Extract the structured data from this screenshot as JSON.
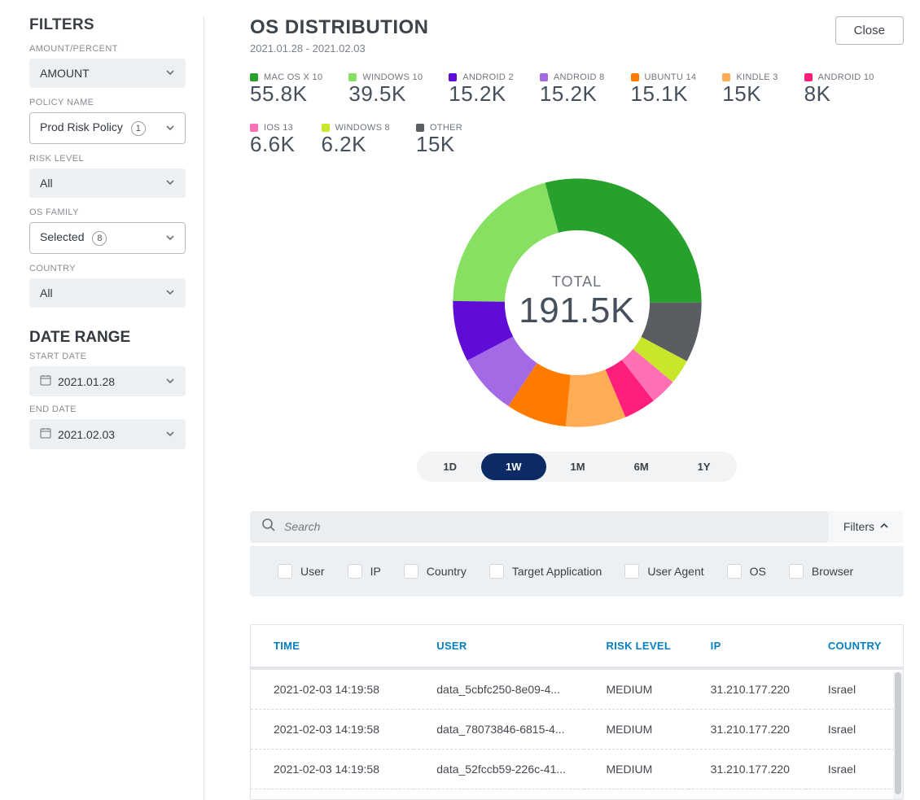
{
  "sidebar": {
    "filters_title": "FILTERS",
    "amount_percent_label": "AMOUNT/PERCENT",
    "amount_percent_value": "AMOUNT",
    "policy_label": "POLICY NAME",
    "policy_value": "Prod Risk Policy",
    "policy_count": "1",
    "risk_label": "RISK LEVEL",
    "risk_value": "All",
    "os_family_label": "OS FAMILY",
    "os_family_value": "Selected",
    "os_family_count": "8",
    "country_label": "COUNTRY",
    "country_value": "All",
    "date_range_title": "DATE RANGE",
    "start_date_label": "START DATE",
    "start_date_value": "2021.01.28",
    "end_date_label": "END DATE",
    "end_date_value": "2021.02.03"
  },
  "header": {
    "title": "OS DISTRIBUTION",
    "subtitle": "2021.01.28 - 2021.02.03",
    "close": "Close"
  },
  "legend": [
    {
      "label": "MAC OS X 10",
      "value": "55.8K",
      "color": "#27a12b"
    },
    {
      "label": "WINDOWS 10",
      "value": "39.5K",
      "color": "#88e063"
    },
    {
      "label": "ANDROID 2",
      "value": "15.2K",
      "color": "#5f0cd6"
    },
    {
      "label": "ANDROID 8",
      "value": "15.2K",
      "color": "#a46ae6"
    },
    {
      "label": "UBUNTU 14",
      "value": "15.1K",
      "color": "#ff7b00"
    },
    {
      "label": "KINDLE 3",
      "value": "15K",
      "color": "#ffad55"
    },
    {
      "label": "ANDROID 10",
      "value": "8K",
      "color": "#ff1f7a"
    },
    {
      "label": "IOS 13",
      "value": "6.6K",
      "color": "#ff6fb4"
    },
    {
      "label": "WINDOWS 8",
      "value": "6.2K",
      "color": "#c9e62b"
    },
    {
      "label": "OTHER",
      "value": "15K",
      "color": "#5a5e63"
    }
  ],
  "chart_data": {
    "type": "pie",
    "title": "OS DISTRIBUTION",
    "total_label": "TOTAL",
    "total_value": "191.5K",
    "series": [
      {
        "name": "MAC OS X 10",
        "value": 55800,
        "color": "#27a12b"
      },
      {
        "name": "WINDOWS 10",
        "value": 39500,
        "color": "#88e063"
      },
      {
        "name": "ANDROID 2",
        "value": 15200,
        "color": "#5f0cd6"
      },
      {
        "name": "ANDROID 8",
        "value": 15200,
        "color": "#a46ae6"
      },
      {
        "name": "UBUNTU 14",
        "value": 15100,
        "color": "#ff7b00"
      },
      {
        "name": "KINDLE 3",
        "value": 15000,
        "color": "#ffad55"
      },
      {
        "name": "ANDROID 10",
        "value": 8000,
        "color": "#ff1f7a"
      },
      {
        "name": "IOS 13",
        "value": 6600,
        "color": "#ff6fb4"
      },
      {
        "name": "WINDOWS 8",
        "value": 6200,
        "color": "#c9e62b"
      },
      {
        "name": "OTHER",
        "value": 15000,
        "color": "#5a5e63"
      }
    ]
  },
  "range_tabs": {
    "options": [
      "1D",
      "1W",
      "1M",
      "6M",
      "1Y"
    ],
    "active": "1W"
  },
  "search": {
    "placeholder": "Search",
    "filters_label": "Filters"
  },
  "filter_chips": [
    "User",
    "IP",
    "Country",
    "Target Application",
    "User Agent",
    "OS",
    "Browser"
  ],
  "table": {
    "columns": [
      "TIME",
      "USER",
      "RISK LEVEL",
      "IP",
      "COUNTRY"
    ],
    "rows": [
      {
        "time": "2021-02-03 14:19:58",
        "user": "data_5cbfc250-8e09-4...",
        "risk": "MEDIUM",
        "ip": "31.210.177.220",
        "country": "Israel"
      },
      {
        "time": "2021-02-03 14:19:58",
        "user": "data_78073846-6815-4...",
        "risk": "MEDIUM",
        "ip": "31.210.177.220",
        "country": "Israel"
      },
      {
        "time": "2021-02-03 14:19:58",
        "user": "data_52fccb59-226c-41...",
        "risk": "MEDIUM",
        "ip": "31.210.177.220",
        "country": "Israel"
      }
    ]
  }
}
